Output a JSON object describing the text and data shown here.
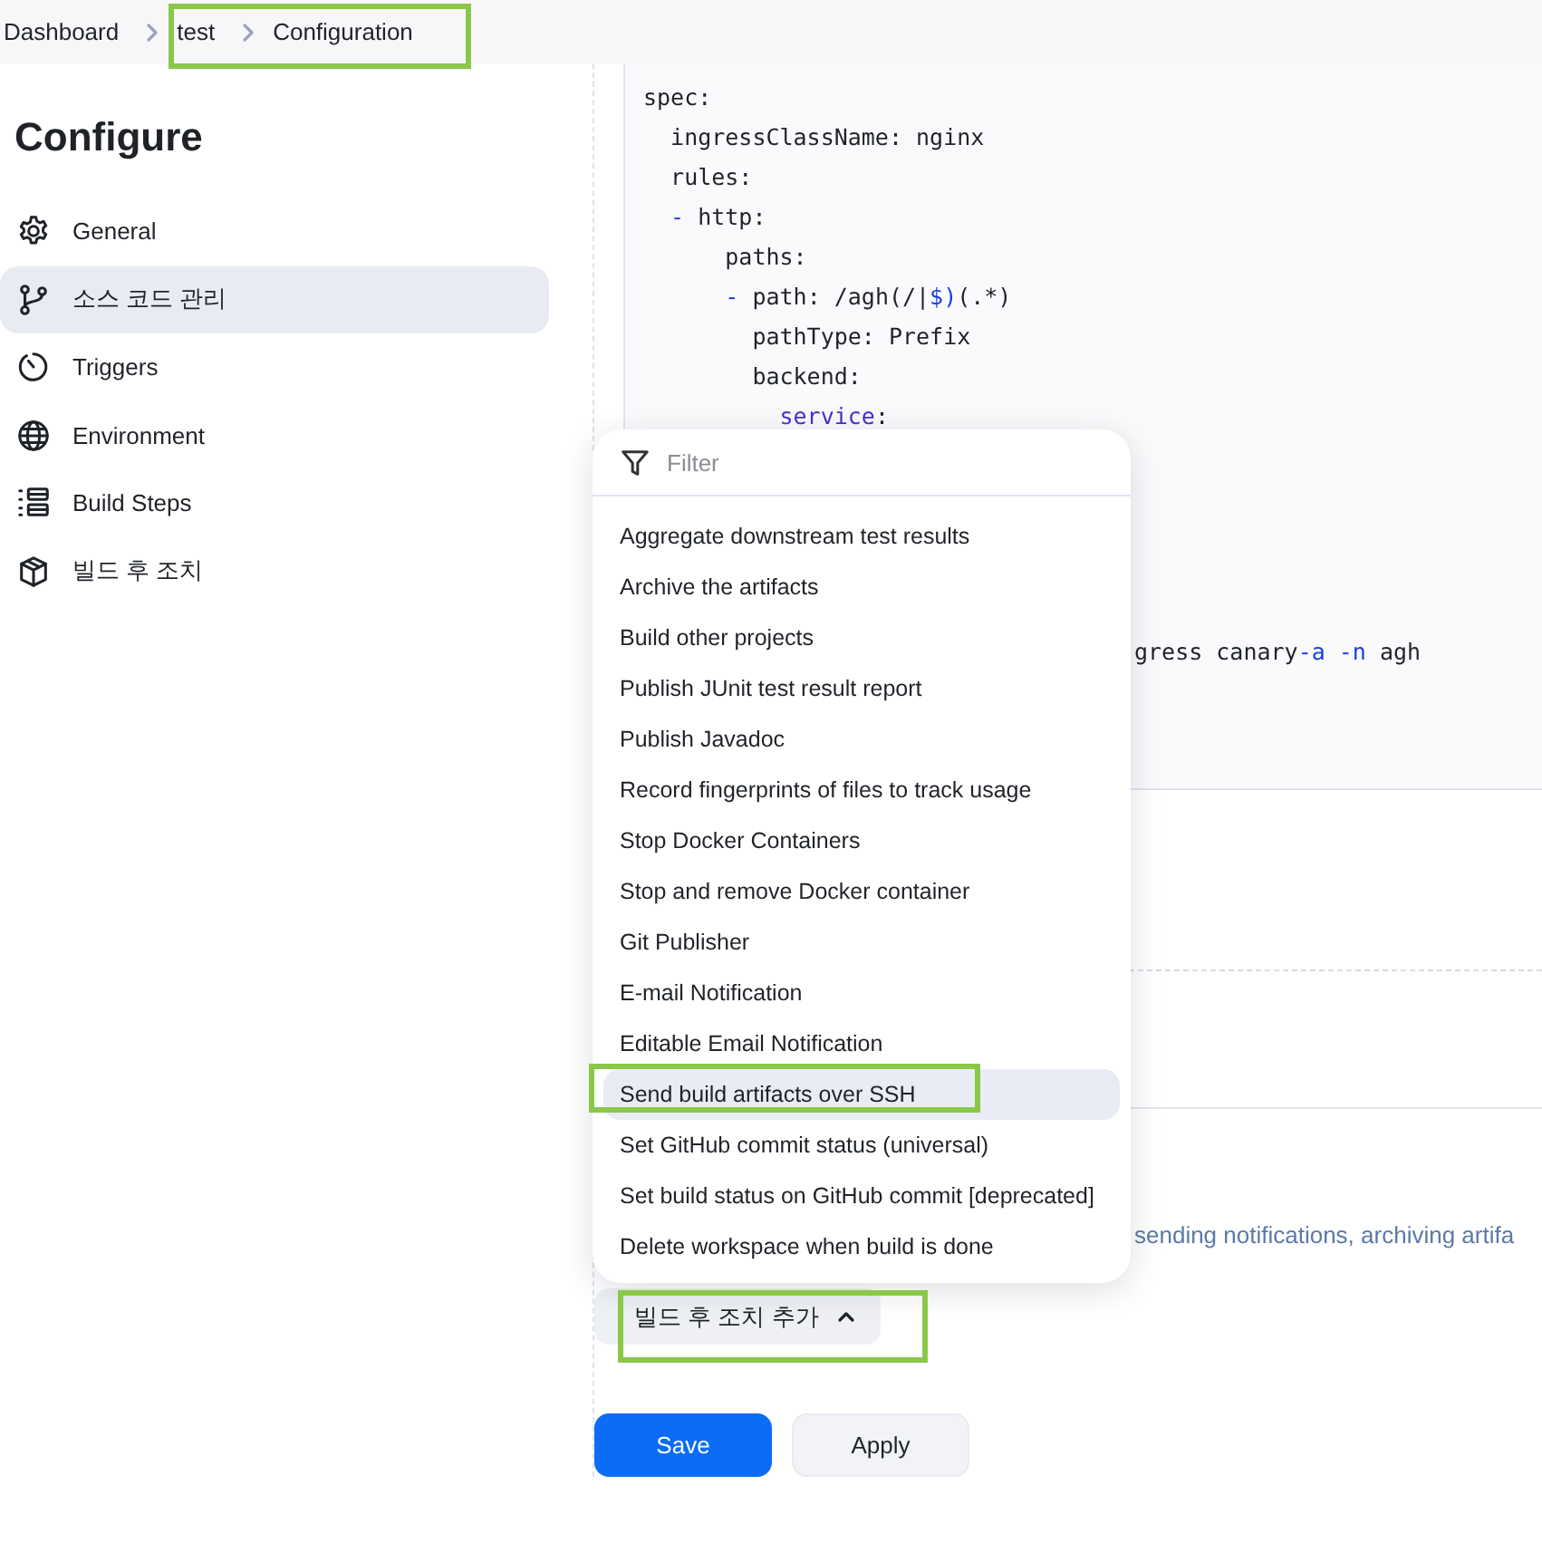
{
  "breadcrumbs": [
    {
      "label": "Dashboard"
    },
    {
      "label": "test"
    },
    {
      "label": "Configuration"
    }
  ],
  "page_title": "Configure",
  "sidebar": {
    "items": [
      {
        "label": "General",
        "selected": false
      },
      {
        "label": "소스 코드 관리",
        "selected": true
      },
      {
        "label": "Triggers",
        "selected": false
      },
      {
        "label": "Environment",
        "selected": false
      },
      {
        "label": "Build Steps",
        "selected": false
      },
      {
        "label": "빌드 후 조치",
        "selected": false
      }
    ]
  },
  "code_editor": {
    "lines": [
      [
        {
          "text": "spec:",
          "kind": "plain"
        }
      ],
      [
        {
          "text": "  ingressClassName: nginx",
          "kind": "plain"
        }
      ],
      [
        {
          "text": "  rules:",
          "kind": "plain"
        }
      ],
      [
        {
          "text": "  -",
          "kind": "punct"
        },
        {
          "text": " http:",
          "kind": "plain"
        }
      ],
      [
        {
          "text": "      paths:",
          "kind": "plain"
        }
      ],
      [
        {
          "text": "      -",
          "kind": "punct"
        },
        {
          "text": " path: /agh(/|",
          "kind": "plain"
        },
        {
          "text": "$)",
          "kind": "punct"
        },
        {
          "text": "(.*)",
          "kind": "plain"
        }
      ],
      [
        {
          "text": "        pathType: Prefix",
          "kind": "plain"
        }
      ],
      [
        {
          "text": "        backend:",
          "kind": "plain"
        }
      ],
      [
        {
          "text": "          service",
          "kind": "keyword"
        },
        {
          "text": ":",
          "kind": "plain"
        }
      ]
    ],
    "partial_line": [
      {
        "text": "gress canary",
        "kind": "plain"
      },
      {
        "text": "-a -n",
        "kind": "punct"
      },
      {
        "text": " agh",
        "kind": "plain"
      }
    ]
  },
  "description": "sending notifications, archiving artifa",
  "dropdown": {
    "filter_placeholder": "Filter",
    "items": [
      {
        "label": "Aggregate downstream test results",
        "selected": false
      },
      {
        "label": "Archive the artifacts",
        "selected": false
      },
      {
        "label": "Build other projects",
        "selected": false
      },
      {
        "label": "Publish JUnit test result report",
        "selected": false
      },
      {
        "label": "Publish Javadoc",
        "selected": false
      },
      {
        "label": "Record fingerprints of files to track usage",
        "selected": false
      },
      {
        "label": "Stop Docker Containers",
        "selected": false
      },
      {
        "label": "Stop and remove Docker container",
        "selected": false
      },
      {
        "label": "Git Publisher",
        "selected": false
      },
      {
        "label": "E-mail Notification",
        "selected": false
      },
      {
        "label": "Editable Email Notification",
        "selected": false
      },
      {
        "label": "Send build artifacts over SSH",
        "selected": true
      },
      {
        "label": "Set GitHub commit status (universal)",
        "selected": false
      },
      {
        "label": "Set build status on GitHub commit [deprecated]",
        "selected": false
      },
      {
        "label": "Delete workspace when build is done",
        "selected": false
      }
    ]
  },
  "add_button": {
    "label": "빌드 후 조치 추가",
    "expanded": true
  },
  "buttons": [
    {
      "label": "Save",
      "kind": "primary"
    },
    {
      "label": "Apply",
      "kind": "secondary"
    }
  ]
}
